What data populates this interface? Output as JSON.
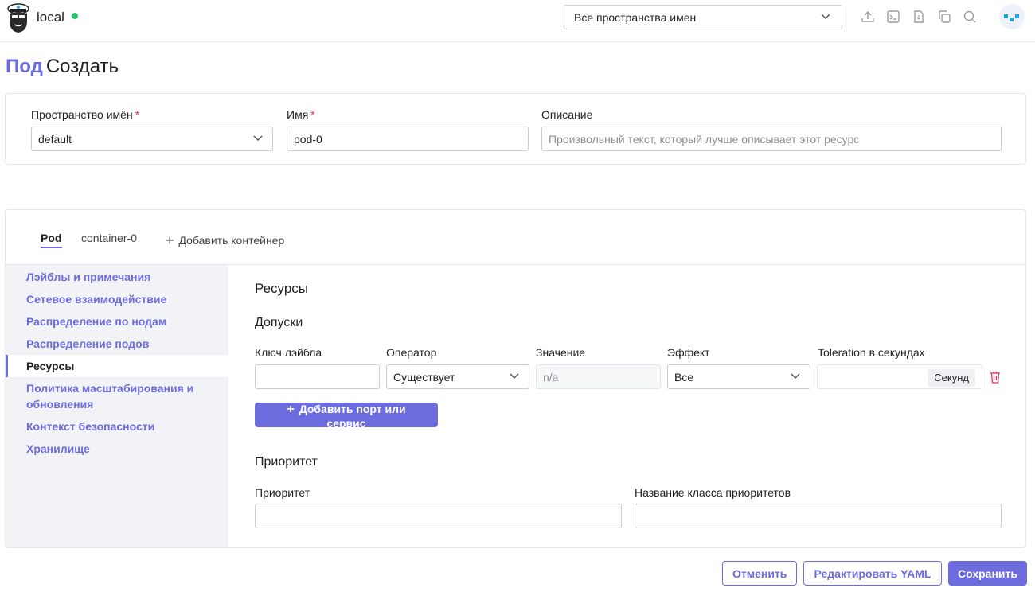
{
  "header": {
    "cluster_name": "local",
    "namespace_select": "Все пространства имен",
    "icons": [
      "upload-icon",
      "terminal-icon",
      "file-icon",
      "copy-icon",
      "search-icon"
    ],
    "colors": {
      "accent": "#6c6cde",
      "status_active": "#28c76f",
      "danger": "#d9355c"
    }
  },
  "title": {
    "resource": "Под",
    "action": "Создать"
  },
  "form": {
    "namespace_label": "Пространство имён",
    "namespace_value": "default",
    "name_label": "Имя",
    "name_value": "pod-0",
    "description_label": "Описание",
    "description_placeholder": "Произвольный текст, который лучше описывает этот ресурс",
    "required_mark": "*"
  },
  "tabs": [
    {
      "label": "Pod"
    },
    {
      "label": "container-0"
    }
  ],
  "add_container": "Добавить контейнер",
  "sidenav": [
    "Лэйблы и примечания",
    "Сетевое взаимодействие",
    "Распределение по нодам",
    "Распределение подов",
    "Ресурсы",
    "Политика масштабирования и обновления",
    "Контекст безопасности",
    "Хранилище"
  ],
  "resources": {
    "heading": "Ресурсы",
    "tolerations_heading": "Допуски",
    "columns": [
      "Ключ лэйбла",
      "Оператор",
      "Значение",
      "Эффект",
      "Toleration в секундах"
    ],
    "row": {
      "key": "",
      "operator": "Существует",
      "value_placeholder": "n/a",
      "effect": "Все",
      "seconds_suffix": "Секунд"
    },
    "add_button": "Добавить порт или сервис"
  },
  "priority": {
    "heading": "Приоритет",
    "priority_label": "Приоритет",
    "class_label": "Название класса приоритетов"
  },
  "footer": {
    "cancel": "Отменить",
    "edit_yaml": "Редактировать YAML",
    "save": "Сохранить"
  }
}
